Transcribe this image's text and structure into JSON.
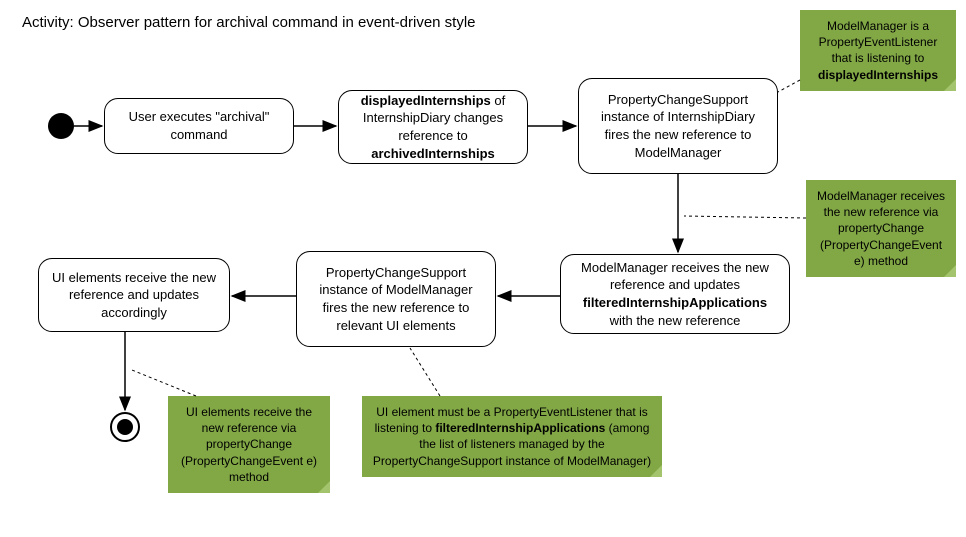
{
  "title": "Activity: Observer pattern for archival command in event-driven style",
  "nodes": {
    "n1": "User executes \"archival\" command",
    "n2": {
      "pre": "displayedInternships",
      "mid": " of InternshipDiary changes reference to ",
      "post": "archivedInternships"
    },
    "n3": "PropertyChangeSupport instance of InternshipDiary fires the new reference to ModelManager",
    "n4": {
      "pre": "ModelManager receives the new reference and updates ",
      "bold": "filteredInternshipApplications",
      "post": " with the new reference"
    },
    "n5": "PropertyChangeSupport instance of ModelManager fires the new reference to relevant UI elements",
    "n6": "UI elements receive the new reference and updates accordingly"
  },
  "notes": {
    "note1": {
      "text1": "ModelManager is a PropertyEventListener that is listening to ",
      "bold": "displayedInternships"
    },
    "note2": "ModelManager receives the new reference via propertyChange (PropertyChangeEvent e) method",
    "note3": {
      "text1": "UI element must be a PropertyEventListener that is listening to ",
      "bold": "filteredInternshipApplications",
      "text2": " (among the list of listeners managed by the PropertyChangeSupport instance of ModelManager)"
    },
    "note4": "UI elements receive the new reference via propertyChange (PropertyChangeEvent e) method"
  }
}
